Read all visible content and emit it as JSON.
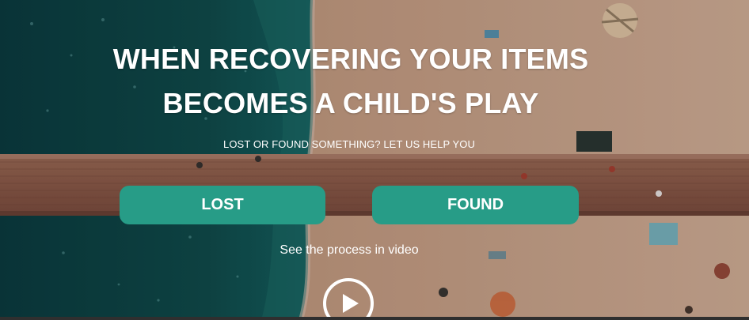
{
  "hero": {
    "headline_line1": "WHEN RECOVERING YOUR ITEMS",
    "headline_line2": "BECOMES A CHILD'S PLAY",
    "subline": "LOST OR FOUND SOMETHING? LET US HELP YOU",
    "buttons": {
      "lost_label": "LOST",
      "found_label": "FOUND"
    },
    "video_prompt": "See the process in video",
    "play_icon": "play-icon"
  },
  "colors": {
    "accent": "#279c87",
    "sea": "#0f3f3f",
    "sand": "#c79f86",
    "pier": "#8c5a47"
  }
}
